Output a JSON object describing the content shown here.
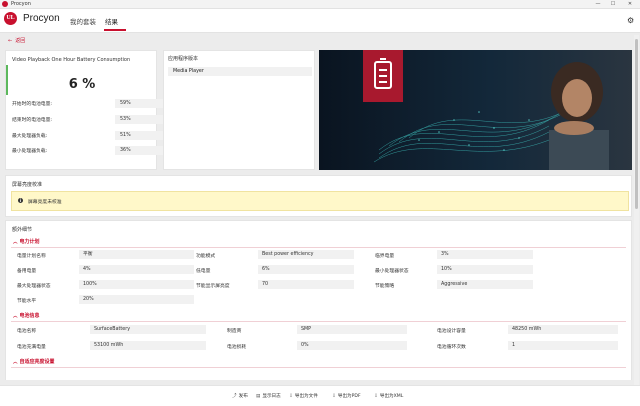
{
  "window": {
    "title": "Procyon",
    "minimize": "—",
    "maximize": "☐",
    "close": "✕"
  },
  "header": {
    "logo": "UL",
    "brand": "Procyon",
    "tabs": [
      {
        "label": "我的套装"
      },
      {
        "label": "结果"
      }
    ]
  },
  "back": {
    "label": "返回"
  },
  "summary": {
    "title": "Video Playback One Hour Battery Consumption",
    "score": "6 %",
    "stats": [
      {
        "label": "开始时的电池电量:",
        "value": "59%"
      },
      {
        "label": "结束时的电池电量:",
        "value": "53%"
      },
      {
        "label": "最大处理器负载:",
        "value": "51%"
      },
      {
        "label": "最小处理器负载:",
        "value": "36%"
      }
    ]
  },
  "app_card": {
    "title": "应用程序版本",
    "value": "Media Player"
  },
  "brightness": {
    "title": "屏幕亮度校准",
    "notice": "屏幕亮度未校准"
  },
  "details": {
    "title": "额外细节",
    "power_plan": {
      "heading": "电力计划",
      "rows": [
        [
          {
            "label": "电量计划名称",
            "value": "平衡"
          },
          {
            "label": "功能模式",
            "value": "Best power efficiency"
          },
          {
            "label": "临界电量",
            "value": "3%"
          }
        ],
        [
          {
            "label": "备用电量",
            "value": "4%"
          },
          {
            "label": "低电量",
            "value": "6%"
          },
          {
            "label": "最小处理器状态",
            "value": "10%"
          }
        ],
        [
          {
            "label": "最大处理器状态",
            "value": "100%"
          },
          {
            "label": "节能显示屏亮度",
            "value": "70"
          },
          {
            "label": "节能策略",
            "value": "Aggressive"
          }
        ],
        [
          {
            "label": "节能水平",
            "value": "20%"
          }
        ]
      ]
    },
    "battery": {
      "heading": "电池信息",
      "rows": [
        [
          {
            "label": "电池名称",
            "value": "SurfaceBattery"
          },
          {
            "label": "制造商",
            "value": "SMP"
          },
          {
            "label": "电池设计容量",
            "value": "48250 mWh"
          }
        ],
        [
          {
            "label": "电池充满电量",
            "value": "53100 mWh"
          },
          {
            "label": "电池损耗",
            "value": "0%"
          },
          {
            "label": "电池循环次数",
            "value": "1"
          }
        ]
      ]
    },
    "adaptive": {
      "heading": "自适应亮度设置"
    }
  },
  "footer": {
    "buttons": [
      {
        "icon": "⤴",
        "label": "发布"
      },
      {
        "icon": "▤",
        "label": "显示日志"
      },
      {
        "icon": "⇩",
        "label": "导出为文件"
      },
      {
        "icon": "⇩",
        "label": "导出为PDF"
      },
      {
        "icon": "⇩",
        "label": "导出为XML"
      }
    ]
  },
  "colors": {
    "accent": "#c8102e",
    "good": "#5cb85c",
    "notice_bg": "#fff8c9"
  }
}
